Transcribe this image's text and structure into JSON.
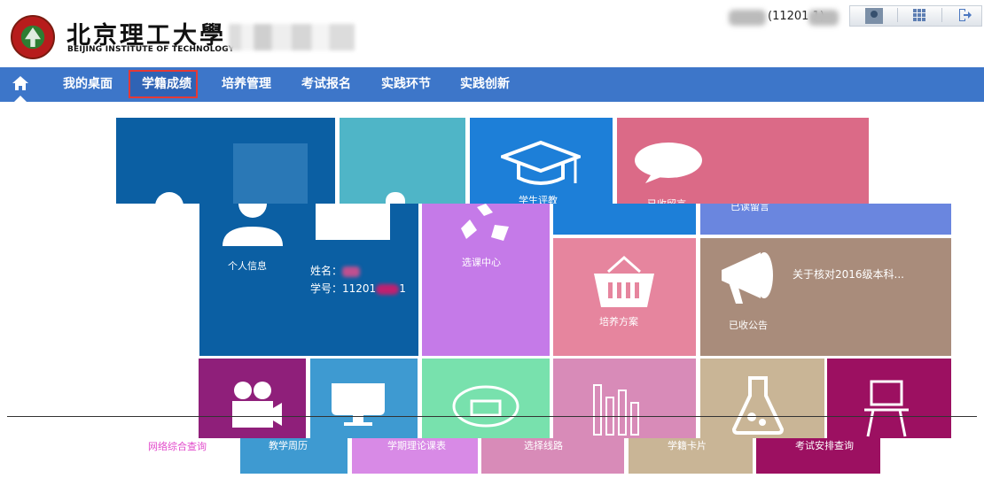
{
  "header": {
    "logo_cn": "北京理工大學",
    "logo_en": "BEIJING INSTITUTE OF TECHNOLOGY",
    "user_label": "(11201   1)"
  },
  "nav": {
    "items": [
      "我的桌面",
      "学籍成绩",
      "培养管理",
      "考试报名",
      "实践环节",
      "实践创新"
    ],
    "active": "学籍成绩"
  },
  "tiles": {
    "student_eval": "学生评教",
    "received_msg": "已收留言",
    "read_msg": "已读留言",
    "personal_info": "个人信息",
    "name_label": "姓名：",
    "student_id_label": "学号：11201",
    "student_id_suffix": "1",
    "course_center": "选课中心",
    "training_plan": "培养方案",
    "received_notice": "已收公告",
    "notice_title": "关于核对2016级本科...",
    "teaching_calendar": "教学周历",
    "semester_schedule": "学期理论课表",
    "route_select": "选择线路",
    "status_card": "学籍卡片",
    "exam_query": "考试安排查询",
    "garbled": "网络综合查询"
  },
  "colors": {
    "nav_blue": "#3d76c9",
    "active_border": "#e53935"
  }
}
